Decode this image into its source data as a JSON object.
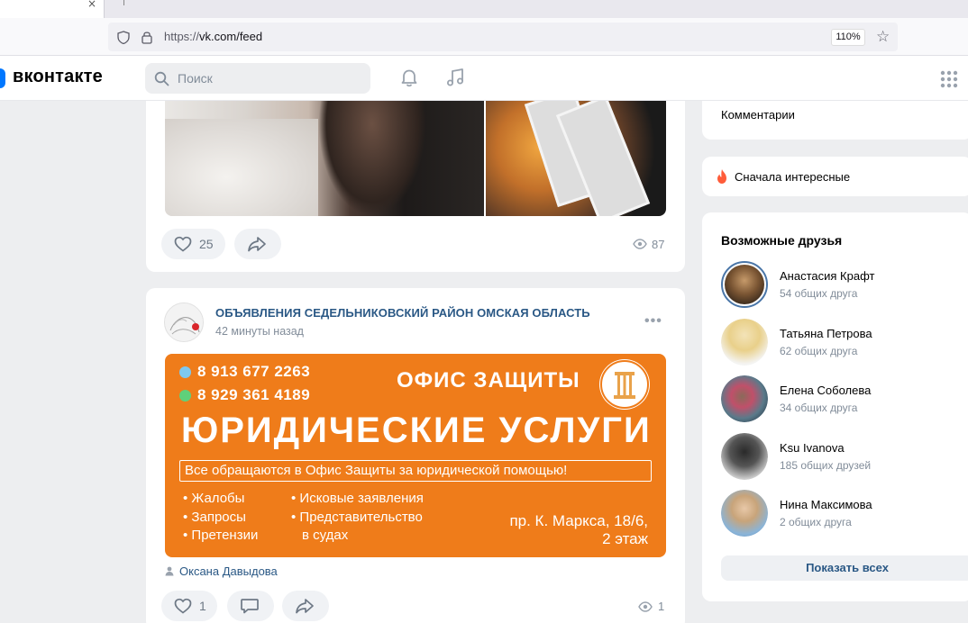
{
  "browser": {
    "tab_close": "×",
    "url_prefix": "https://",
    "url_main": "vk.com/feed",
    "zoom": "110%"
  },
  "header": {
    "logo_text": "вконтакте",
    "search_placeholder": "Поиск"
  },
  "feed": {
    "post1": {
      "likes": "25",
      "views": "87"
    },
    "post2": {
      "group_name": "ОБЪЯВЛЕНИЯ СЕДЕЛЬНИКОВСКИЙ РАЙОН ОМСКАЯ ОБЛАСТЬ",
      "time": "42 минуты назад",
      "banner": {
        "phone1": "8 913 677 2263",
        "phone2": "8 929 361 4189",
        "office": "ОФИС ЗАЩИТЫ",
        "title": "ЮРИДИЧЕСКИЕ УСЛУГИ",
        "tagline": "Все обращаются в Офис Защиты за юридической помощью!",
        "items_left": [
          "• Жалобы",
          "• Запросы",
          "• Претензии"
        ],
        "items_right": [
          "• Исковые заявления",
          "• Представительство",
          "в судах"
        ],
        "address_line1": "пр. К. Маркса, 18/6,",
        "address_line2": "2 этаж"
      },
      "author": "Оксана Давыдова",
      "likes": "1",
      "views": "1"
    }
  },
  "sidebar": {
    "comments_label": "Комментарии",
    "sort_label": "Сначала интересные",
    "friends_title": "Возможные друзья",
    "friends": [
      {
        "name": "Анастасия Крафт",
        "mutual": "54 общих друга"
      },
      {
        "name": "Татьяна Петрова",
        "mutual": "62 общих друга"
      },
      {
        "name": "Елена Соболева",
        "mutual": "34 общих друга"
      },
      {
        "name": "Ksu Ivanova",
        "mutual": "185 общих друзей"
      },
      {
        "name": "Нина Максимова",
        "mutual": "2 общих друга"
      }
    ],
    "show_all": "Показать всех"
  },
  "colors": {
    "vk_blue": "#0077ff",
    "link": "#2a5885",
    "banner_orange": "#ef7c1a"
  }
}
